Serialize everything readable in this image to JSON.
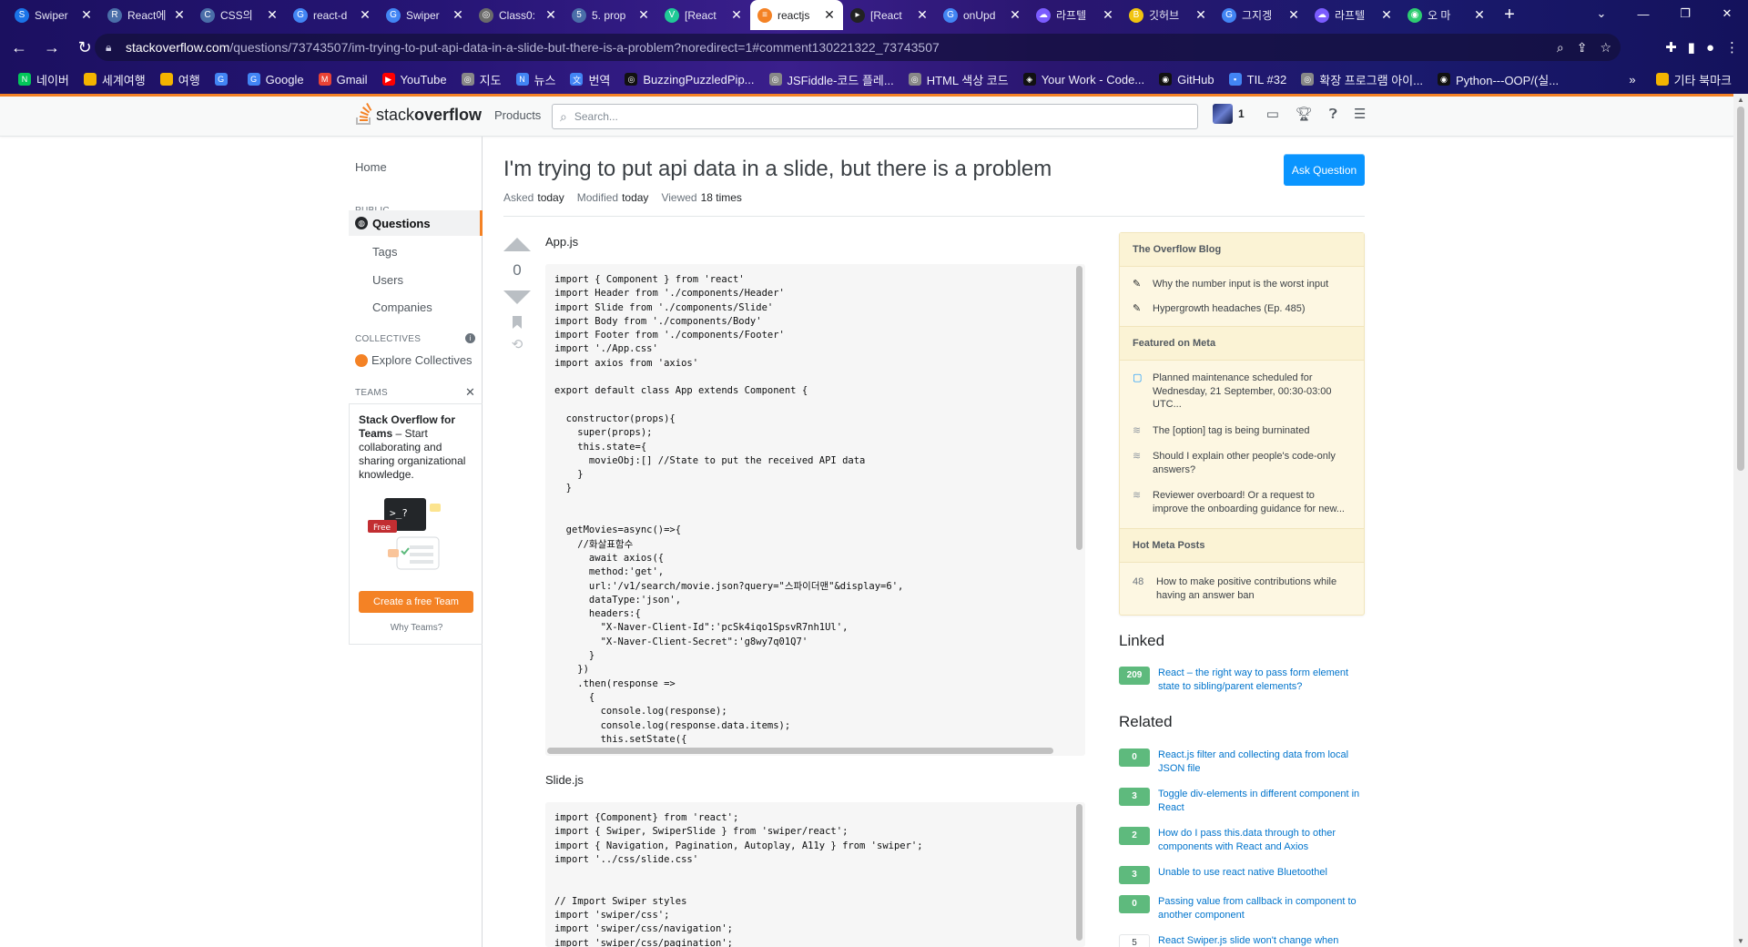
{
  "browser": {
    "tabs": [
      {
        "label": "Swiper",
        "color": "#1a73e8",
        "glyph": "S"
      },
      {
        "label": "React에",
        "color": "#4a6ea9",
        "glyph": "R"
      },
      {
        "label": "CSS의",
        "color": "#4a6ea9",
        "glyph": "C"
      },
      {
        "label": "react-d",
        "color": "#4285f4",
        "glyph": "G"
      },
      {
        "label": "Swiper",
        "color": "#4285f4",
        "glyph": "G"
      },
      {
        "label": "Class0:",
        "color": "#6b6b6b",
        "glyph": "◎"
      },
      {
        "label": "5. prop",
        "color": "#4a6ea9",
        "glyph": "5"
      },
      {
        "label": "[React",
        "color": "#20c997",
        "glyph": "V"
      },
      {
        "label": "reactjs",
        "color": "#f48225",
        "glyph": "≡",
        "active": true
      },
      {
        "label": "[React",
        "color": "#222",
        "glyph": "▸"
      },
      {
        "label": "onUpd",
        "color": "#4285f4",
        "glyph": "G"
      },
      {
        "label": "라프텔",
        "color": "#7b5cff",
        "glyph": "☁"
      },
      {
        "label": "깃허브",
        "color": "#f1c40f",
        "glyph": "B"
      },
      {
        "label": "그지겡",
        "color": "#4285f4",
        "glyph": "G"
      },
      {
        "label": "라프텔",
        "color": "#7b5cff",
        "glyph": "☁"
      },
      {
        "label": "오 마",
        "color": "#2ecc71",
        "glyph": "◉"
      }
    ],
    "new_tab": "+",
    "window_controls": [
      "⌄",
      "—",
      "❐",
      "✕"
    ],
    "url_host": "stackoverflow.com",
    "url_path": "/questions/73743507/im-trying-to-put-api-data-in-a-slide-but-there-is-a-problem?noredirect=1#comment130221322_73743507",
    "bookmarks": [
      {
        "label": "네이버",
        "color": "#03c75a",
        "glyph": "N"
      },
      {
        "label": "세계여행",
        "color": "#f4b400",
        "glyph": ""
      },
      {
        "label": "여행",
        "color": "#f4b400",
        "glyph": ""
      },
      {
        "label": "",
        "color": "#4285f4",
        "glyph": "G"
      },
      {
        "label": "Google",
        "color": "#4285f4",
        "glyph": "G"
      },
      {
        "label": "Gmail",
        "color": "#ea4335",
        "glyph": "M"
      },
      {
        "label": "YouTube",
        "color": "#ff0000",
        "glyph": "▶"
      },
      {
        "label": "지도",
        "color": "#888",
        "glyph": "◎"
      },
      {
        "label": "뉴스",
        "color": "#4285f4",
        "glyph": "N"
      },
      {
        "label": "번역",
        "color": "#4285f4",
        "glyph": "文"
      },
      {
        "label": "BuzzingPuzzledPip...",
        "color": "#111",
        "glyph": "◎"
      },
      {
        "label": "JSFiddle-코드 플레...",
        "color": "#888",
        "glyph": "◎"
      },
      {
        "label": "HTML 색상 코드",
        "color": "#888",
        "glyph": "◎"
      },
      {
        "label": "Your Work - Code...",
        "color": "#111",
        "glyph": "◈"
      },
      {
        "label": "GitHub",
        "color": "#111",
        "glyph": "◉"
      },
      {
        "label": "TIL #32",
        "color": "#4285f4",
        "glyph": "▪"
      },
      {
        "label": "확장 프로그램 아이...",
        "color": "#888",
        "glyph": "◎"
      },
      {
        "label": "Python---OOP/(실...",
        "color": "#111",
        "glyph": "◉"
      }
    ],
    "bookmarks_more": "»",
    "other_bookmarks": "기타 북마크"
  },
  "so": {
    "logo_plain": "stack",
    "logo_bold": "overflow",
    "products": "Products",
    "search_placeholder": "Search...",
    "reputation": "1"
  },
  "left_nav": {
    "home": "Home",
    "public_header": "PUBLIC",
    "questions": "Questions",
    "tags": "Tags",
    "users": "Users",
    "companies": "Companies",
    "collectives_header": "COLLECTIVES",
    "explore_collectives": "Explore Collectives",
    "teams_header": "TEAMS",
    "teams_title": "Stack Overflow for Teams",
    "teams_desc": " – Start collaborating and sharing organizational knowledge.",
    "free_badge": "Free",
    "create_team": "Create a free Team",
    "why_teams": "Why Teams?"
  },
  "question": {
    "title": "I'm trying to put api data in a slide, but there is a problem",
    "ask_button": "Ask Question",
    "asked_label": "Asked",
    "asked_value": "today",
    "modified_label": "Modified",
    "modified_value": "today",
    "viewed_label": "Viewed",
    "viewed_value": "18 times",
    "votes": "0",
    "file1": "App.js",
    "code1": "import { Component } from 'react'\nimport Header from './components/Header'\nimport Slide from './components/Slide'\nimport Body from './components/Body'\nimport Footer from './components/Footer'\nimport './App.css'\nimport axios from 'axios'\n\nexport default class App extends Component {\n\n  constructor(props){\n    super(props);\n    this.state={\n      movieObj:[] //State to put the received API data\n    }\n  }\n\n\n  getMovies=async()=>{\n    //화살표함수\n      await axios({\n      method:'get',\n      url:'/v1/search/movie.json?query=\"스파이더맨\"&display=6',\n      dataType:'json',\n      headers:{\n        \"X-Naver-Client-Id\":'pcSk4iqo1SpsvR7nh1Ul',\n        \"X-Naver-Client-Secret\":'g8wy7q01Q7'\n      }\n    })\n    .then(response =>\n      {\n        console.log(response);\n        console.log(response.data.items);\n        this.setState({",
    "file2": "Slide.js",
    "code2": "import {Component} from 'react';\nimport { Swiper, SwiperSlide } from 'swiper/react';\nimport { Navigation, Pagination, Autoplay, A11y } from 'swiper';\nimport '../css/slide.css'\n\n\n// Import Swiper styles\nimport 'swiper/css';\nimport 'swiper/css/navigation';\nimport 'swiper/css/pagination';"
  },
  "sidebar": {
    "blog_header": "The Overflow Blog",
    "blog_items": [
      "Why the number input is the worst input",
      "Hypergrowth headaches (Ep. 485)"
    ],
    "meta_header": "Featured on Meta",
    "meta_items": [
      "Planned maintenance scheduled for Wednesday, 21 September, 00:30-03:00 UTC...",
      "The [option] tag is being burninated",
      "Should I explain other people's code-only answers?",
      "Reviewer overboard! Or a request to improve the onboarding guidance for new..."
    ],
    "hot_header": "Hot Meta Posts",
    "hot_items": [
      {
        "score": "48",
        "text": "How to make positive contributions while having an answer ban"
      }
    ],
    "linked_header": "Linked",
    "linked": [
      {
        "score": "209",
        "text": "React – the right way to pass form element state to sibling/parent elements?"
      }
    ],
    "related_header": "Related",
    "related": [
      {
        "score": "0",
        "text": "React.js filter and collecting data from local JSON file"
      },
      {
        "score": "3",
        "text": "Toggle div-elements in different component in React"
      },
      {
        "score": "2",
        "text": "How do I pass this.data through to other components with React and Axios"
      },
      {
        "score": "3",
        "text": "Unable to use react native Bluetoothel"
      },
      {
        "score": "0",
        "text": "Passing value from callback in component to another component"
      },
      {
        "score": "5",
        "text": "React Swiper.js slide won't change when",
        "plain": true
      }
    ]
  },
  "colors": {
    "so_orange": "#f48225",
    "so_blue": "#0a95ff",
    "accepted_green": "#5eba7d",
    "blog_bg": "#fdf7e2"
  }
}
